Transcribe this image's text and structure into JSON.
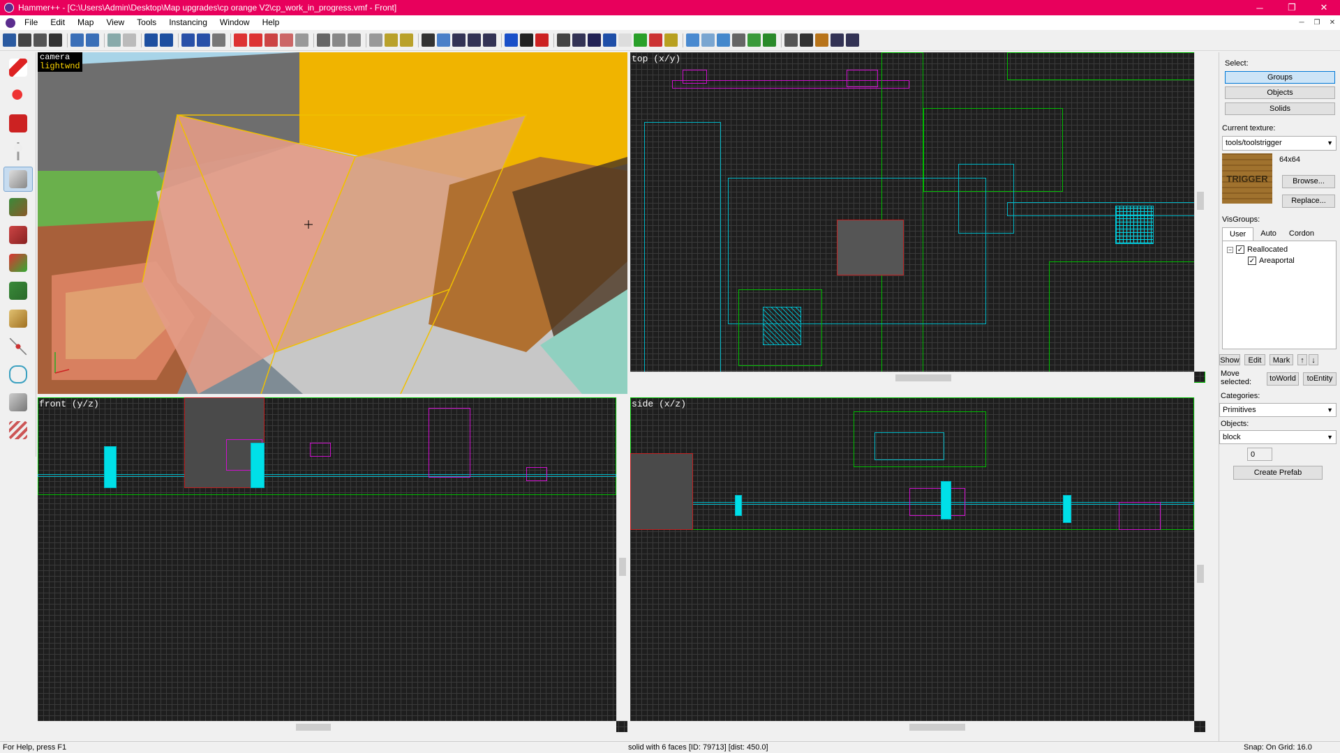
{
  "window": {
    "title": "Hammer++ - [C:\\Users\\Admin\\Desktop\\Map upgrades\\cp orange V2\\cp_work_in_progress.vmf - Front]",
    "minimize": "─",
    "maximize": "❐",
    "close": "✕"
  },
  "menu": [
    "File",
    "Edit",
    "Map",
    "View",
    "Tools",
    "Instancing",
    "Window",
    "Help"
  ],
  "viewports": {
    "camera": {
      "label1": "camera",
      "label2": "lightwnd"
    },
    "top": {
      "label": "top (x/y)"
    },
    "front": {
      "label": "front (y/z)"
    },
    "side": {
      "label": "side (x/z)"
    }
  },
  "panel": {
    "select_label": "Select:",
    "select_buttons": [
      "Groups",
      "Objects",
      "Solids"
    ],
    "current_texture_label": "Current texture:",
    "current_texture": "tools/toolstrigger",
    "texture_size": "64x64",
    "texture_preview_text": "TRIGGER",
    "browse": "Browse...",
    "replace": "Replace...",
    "visgroups_label": "VisGroups:",
    "visgroup_tabs": [
      "User",
      "Auto",
      "Cordon"
    ],
    "visgroups": [
      {
        "name": "Reallocated",
        "checked": true
      },
      {
        "name": "Areaportal",
        "checked": true
      }
    ],
    "vis_buttons": [
      "Show",
      "Edit",
      "Mark"
    ],
    "move_selected_label": "Move selected:",
    "to_world": "toWorld",
    "to_entity": "toEntity",
    "categories_label": "Categories:",
    "categories_value": "Primitives",
    "objects_label": "Objects:",
    "objects_value": "block",
    "stepper_value": "0",
    "create_prefab": "Create Prefab"
  },
  "status": {
    "help": "For Help, press F1",
    "selection": "solid with 6 faces  [ID: 79713]  [dist: 450.0]",
    "snap": "Snap: On Grid: 16.0"
  },
  "colors": {
    "titlebar": "#e8005c",
    "selection": "#f0c000",
    "wire_green": "#00c000",
    "wire_cyan": "#00b8c8",
    "wire_magenta": "#d010d0"
  }
}
